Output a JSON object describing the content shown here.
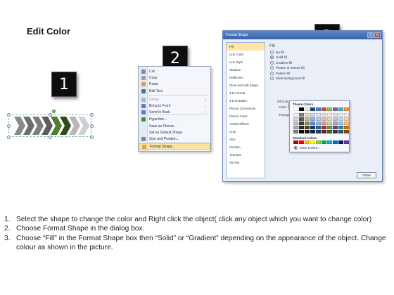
{
  "title": "Edit Color",
  "badges": [
    "1",
    "2",
    "3"
  ],
  "context_menu": {
    "items": [
      {
        "label": "Cut",
        "icon": "scissors-icon",
        "color": "#7a8aa8",
        "disabled": false
      },
      {
        "label": "Copy",
        "icon": "copy-icon",
        "color": "#8da0c0",
        "disabled": false
      },
      {
        "label": "Paste",
        "icon": "paste-icon",
        "color": "#c9a64a",
        "disabled": false
      },
      {
        "label": "Edit Text",
        "icon": "edit-text-icon",
        "color": "#4d6fa6",
        "disabled": false
      },
      {
        "label": "Group",
        "icon": "group-icon",
        "color": "#b0b6c2",
        "disabled": true,
        "submenu": true
      },
      {
        "label": "Bring to Front",
        "icon": "bring-front-icon",
        "color": "#5a7fc0",
        "disabled": false,
        "submenu": true
      },
      {
        "label": "Send to Back",
        "icon": "send-back-icon",
        "color": "#5a7fc0",
        "disabled": false,
        "submenu": true
      },
      {
        "label": "Hyperlink...",
        "icon": "hyperlink-icon",
        "color": "#3e8e4e",
        "disabled": false
      },
      {
        "label": "Save as Picture...",
        "icon": "none",
        "color": "transparent",
        "disabled": false
      },
      {
        "label": "Set as Default Shape",
        "icon": "none",
        "color": "transparent",
        "disabled": false
      },
      {
        "label": "Size and Position...",
        "icon": "size-position-icon",
        "color": "#6d86b5",
        "disabled": false
      },
      {
        "label": "Format Shape...",
        "icon": "format-shape-icon",
        "color": "#e0a53a",
        "disabled": false,
        "highlighted": true
      }
    ]
  },
  "dialog": {
    "title": "Format Shape",
    "help": "?",
    "close_x": "X",
    "nav": [
      "Fill",
      "Line Color",
      "Line Style",
      "Shadow",
      "Reflection",
      "Glow and Soft Edges",
      "3-D Format",
      "3-D Rotation",
      "Picture Corrections",
      "Picture Color",
      "Artistic Effects",
      "Crop",
      "Size",
      "Position",
      "Text Box",
      "Alt Text"
    ],
    "panel_title": "Fill",
    "options": [
      "No fill",
      "Solid fill",
      "Gradient fill",
      "Picture or texture fill",
      "Pattern fill",
      "Slide background fill"
    ],
    "selected_option": 1,
    "fill_color_group": "Fill Color",
    "color_label": "Color:",
    "transparency_label": "Transpa",
    "close_button": "Close"
  },
  "palette": {
    "theme_label": "Theme Colors",
    "standard_label": "Standard Colors",
    "more_label": "More Colors...",
    "theme_top": [
      "#ffffff",
      "#000000",
      "#eeece1",
      "#1f497d",
      "#4f81bd",
      "#c0504d",
      "#9bbb59",
      "#8064a2",
      "#4bacc6",
      "#f79646"
    ],
    "theme_cols": [
      [
        "#f2f2f2",
        "#d9d9d9",
        "#bfbfbf",
        "#a6a6a6",
        "#808080"
      ],
      [
        "#7f7f7f",
        "#595959",
        "#404040",
        "#262626",
        "#0d0d0d"
      ],
      [
        "#ddd9c3",
        "#c4bd97",
        "#938953",
        "#494429",
        "#1d1b10"
      ],
      [
        "#c6d9f0",
        "#8db3e2",
        "#548dd4",
        "#17365d",
        "#0f243e"
      ],
      [
        "#dbe5f1",
        "#b8cce4",
        "#95b3d7",
        "#366092",
        "#244061"
      ],
      [
        "#f2dcdb",
        "#e5b9b7",
        "#d99694",
        "#953734",
        "#632423"
      ],
      [
        "#ebf1dd",
        "#d7e3bc",
        "#c3d69b",
        "#76923c",
        "#4f6128"
      ],
      [
        "#e5e0ec",
        "#ccc1d9",
        "#b2a2c7",
        "#5f497a",
        "#3f3151"
      ],
      [
        "#dbeef3",
        "#b7dde8",
        "#92cddc",
        "#31859b",
        "#205867"
      ],
      [
        "#fdeada",
        "#fbd5b5",
        "#fac08f",
        "#e36c09",
        "#974806"
      ]
    ],
    "standard": [
      "#c00000",
      "#ff0000",
      "#ffc000",
      "#ffff00",
      "#92d050",
      "#00b050",
      "#00b0f0",
      "#0070c0",
      "#002060",
      "#7030a0"
    ]
  },
  "chevrons": [
    "#8a8a8a",
    "#6e6e6e",
    "#7d7d7d",
    "#5e5e5e",
    "#4f7f2a",
    "#2f4a1c",
    "#b8b8b8",
    "#d0d0d0"
  ],
  "instructions": [
    {
      "num": "1.",
      "text": "Select the shape to change the color and Right click the object( click any object which you want to change color)"
    },
    {
      "num": "2.",
      "text": "Choose Format Shape in the dialog box."
    },
    {
      "num": "3.",
      "text": "Choose “Fill” in the Format Shape box then “Solid” or “Gradient” depending on the appearance of the object. Change colour as shown in the picture."
    }
  ]
}
